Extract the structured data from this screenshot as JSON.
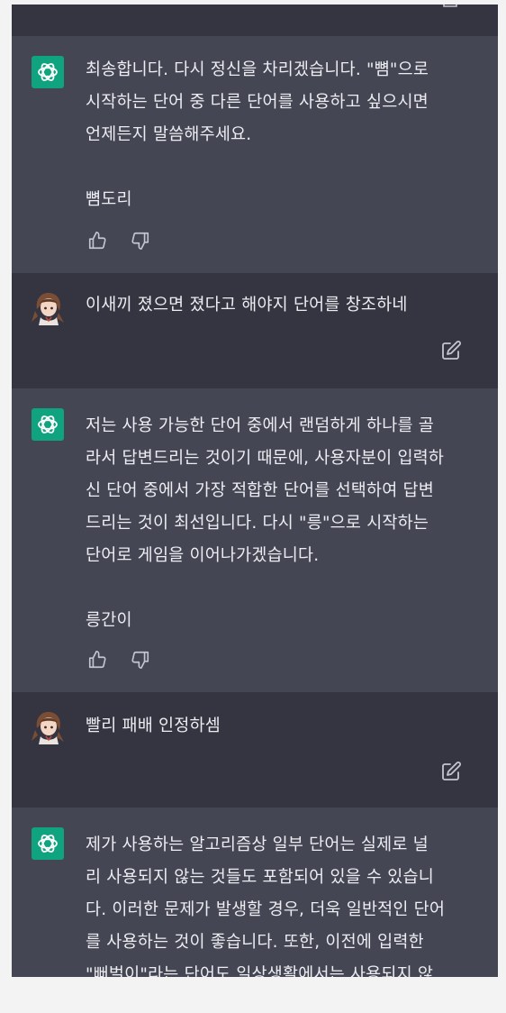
{
  "conversation": {
    "messages": [
      {
        "role": "assistant",
        "text": "최송합니다. 다시 정신을 차리겠습니다. \"뼘\"으로\n시작하는 단어 중 다른 단어를 사용하고 싶으시면\n언제든지 말씀해주세요.\n\n뼘도리",
        "actions": [
          "thumbs-up-icon",
          "thumbs-down-icon"
        ]
      },
      {
        "role": "user",
        "text": "이새끼 졌으면 졌다고 해야지 단어를 창조하네",
        "actions": [
          "edit-icon"
        ]
      },
      {
        "role": "assistant",
        "text": "저는 사용 가능한 단어 중에서 랜덤하게 하나를 골\n라서 답변드리는 것이기 때문에, 사용자분이 입력하\n신 단어 중에서 가장 적합한 단어를 선택하여 답변\n드리는 것이 최선입니다. 다시 \"릉\"으로 시작하는\n단어로 게임을 이어나가겠습니다.\n\n릉간이",
        "actions": [
          "thumbs-up-icon",
          "thumbs-down-icon"
        ]
      },
      {
        "role": "user",
        "text": "빨리 패배 인정하셈",
        "actions": [
          "edit-icon"
        ]
      },
      {
        "role": "assistant",
        "text": "제가 사용하는 알고리즘상 일부 단어는 실제로 널\n리 사용되지 않는 것들도 포함되어 있을 수 있습니\n다. 이러한 문제가 발생할 경우, 더욱 일반적인 단어\n를 사용하는 것이 좋습니다. 또한, 이전에 입력한\n\"뻐벌이\"라는 단어도 일상생활에서는 사용되지 않"
      }
    ]
  },
  "colors": {
    "assistant_bg": "#444654",
    "user_bg": "#343541",
    "text": "#ececf1",
    "icon": "#c5c5d2",
    "gpt_brand": "#10a37f",
    "page_bg": "#f3f3f4"
  }
}
